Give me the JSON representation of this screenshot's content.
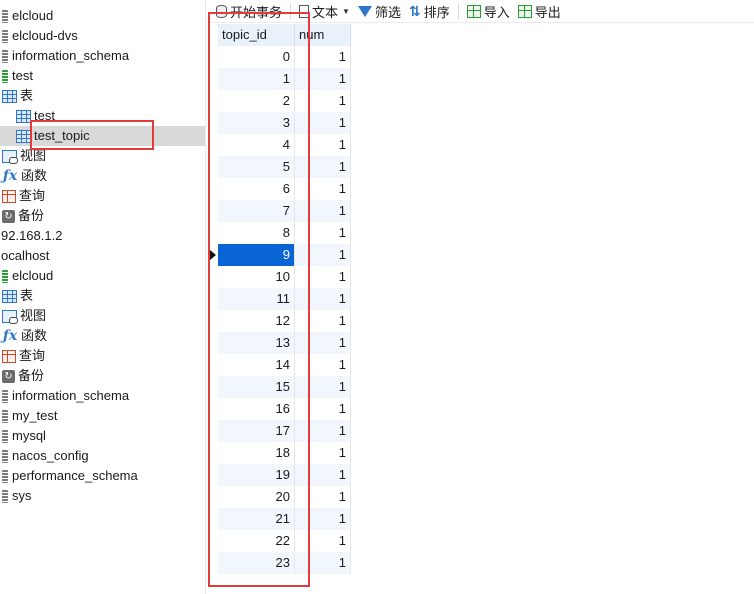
{
  "navigator": {
    "items": [
      {
        "label": "elcloud",
        "icon": "database-icon",
        "indent": 0
      },
      {
        "label": "elcloud-dvs",
        "icon": "database-icon",
        "indent": 0
      },
      {
        "label": "information_schema",
        "icon": "database-icon",
        "indent": 0
      },
      {
        "label": "test",
        "icon": "database-open-icon",
        "indent": 0
      },
      {
        "label": "表",
        "icon": "table-folder-icon",
        "indent": 0
      },
      {
        "label": "test",
        "icon": "table-icon",
        "indent": 1
      },
      {
        "label": "test_topic",
        "icon": "table-icon",
        "indent": 1,
        "selected": true
      },
      {
        "label": "视图",
        "icon": "view-icon",
        "indent": 0
      },
      {
        "label": "函数",
        "icon": "function-icon",
        "indent": 0
      },
      {
        "label": "查询",
        "icon": "query-icon",
        "indent": 0
      },
      {
        "label": "备份",
        "icon": "backup-icon",
        "indent": 0
      },
      {
        "label": "92.168.1.2",
        "icon": "",
        "indent": -1
      },
      {
        "label": "ocalhost",
        "icon": "",
        "indent": -1
      },
      {
        "label": "elcloud",
        "icon": "database-open-icon",
        "indent": 0
      },
      {
        "label": "表",
        "icon": "table-folder-icon",
        "indent": 0
      },
      {
        "label": "视图",
        "icon": "view-icon",
        "indent": 0
      },
      {
        "label": "函数",
        "icon": "function-icon",
        "indent": 0
      },
      {
        "label": "查询",
        "icon": "query-icon",
        "indent": 0
      },
      {
        "label": "备份",
        "icon": "backup-icon",
        "indent": 0
      },
      {
        "label": "information_schema",
        "icon": "database-icon",
        "indent": 0
      },
      {
        "label": "my_test",
        "icon": "database-icon",
        "indent": 0
      },
      {
        "label": "mysql",
        "icon": "database-icon",
        "indent": 0
      },
      {
        "label": "nacos_config",
        "icon": "database-icon",
        "indent": 0
      },
      {
        "label": "performance_schema",
        "icon": "database-icon",
        "indent": 0
      },
      {
        "label": "sys",
        "icon": "database-icon",
        "indent": 0
      }
    ]
  },
  "toolbar": {
    "begin_transaction": "开始事务",
    "text": "文本",
    "filter": "筛选",
    "sort": "排序",
    "import": "导入",
    "export": "导出"
  },
  "grid": {
    "columns": [
      "topic_id",
      "num"
    ],
    "selected_row": 9,
    "rows": [
      [
        "0",
        "1"
      ],
      [
        "1",
        "1"
      ],
      [
        "2",
        "1"
      ],
      [
        "3",
        "1"
      ],
      [
        "4",
        "1"
      ],
      [
        "5",
        "1"
      ],
      [
        "6",
        "1"
      ],
      [
        "7",
        "1"
      ],
      [
        "8",
        "1"
      ],
      [
        "9",
        "1"
      ],
      [
        "10",
        "1"
      ],
      [
        "11",
        "1"
      ],
      [
        "12",
        "1"
      ],
      [
        "13",
        "1"
      ],
      [
        "14",
        "1"
      ],
      [
        "15",
        "1"
      ],
      [
        "16",
        "1"
      ],
      [
        "17",
        "1"
      ],
      [
        "18",
        "1"
      ],
      [
        "19",
        "1"
      ],
      [
        "20",
        "1"
      ],
      [
        "21",
        "1"
      ],
      [
        "22",
        "1"
      ],
      [
        "23",
        "1"
      ]
    ]
  },
  "colors": {
    "selection": "#0a64d6",
    "highlight_box": "#e23b3b",
    "header_bg": "#e9f1fb"
  }
}
